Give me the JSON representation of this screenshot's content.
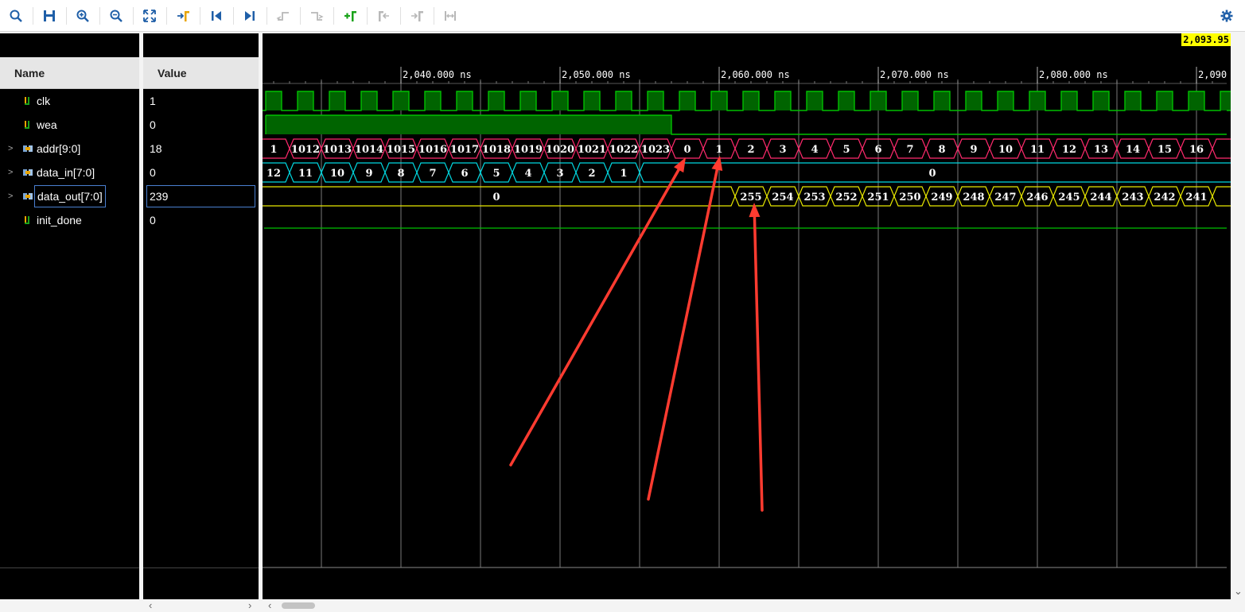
{
  "colors": {
    "signal_green": "#00c000",
    "signal_fill": "#006400",
    "bus_pink": "#ff2a6d",
    "bus_cyan": "#00d8e0",
    "bus_yellow": "#e8e800",
    "cursor_yellow": "#ffff00",
    "arrow_red": "#ff3b30",
    "toolbar_blue": "#1f5fa8"
  },
  "toolbar": {
    "buttons": [
      {
        "name": "search-icon",
        "icon": "magnifier"
      },
      {
        "name": "save-icon",
        "icon": "floppy"
      },
      {
        "name": "zoom-in-icon",
        "icon": "zoom-in"
      },
      {
        "name": "zoom-out-icon",
        "icon": "zoom-out"
      },
      {
        "name": "zoom-fit-icon",
        "icon": "fit"
      },
      {
        "name": "go-to-cursor-icon",
        "icon": "cursor"
      },
      {
        "name": "go-to-start-icon",
        "icon": "first"
      },
      {
        "name": "go-to-end-icon",
        "icon": "last"
      },
      {
        "name": "previous-transition-icon",
        "icon": "prev-edge"
      },
      {
        "name": "next-transition-icon",
        "icon": "next-edge"
      },
      {
        "name": "add-marker-icon",
        "icon": "add-marker"
      },
      {
        "name": "previous-marker-icon",
        "icon": "prev-marker"
      },
      {
        "name": "next-marker-icon",
        "icon": "next-marker"
      },
      {
        "name": "swap-cursors-icon",
        "icon": "swap"
      }
    ],
    "settings_icon": "gear-icon"
  },
  "headers": {
    "name": "Name",
    "value": "Value"
  },
  "signals": [
    {
      "name": "clk",
      "value": "1",
      "kind": "bit",
      "expandable": false
    },
    {
      "name": "wea",
      "value": "0",
      "kind": "bit",
      "expandable": false
    },
    {
      "name": "addr[9:0]",
      "value": "18",
      "kind": "bus",
      "expandable": true
    },
    {
      "name": "data_in[7:0]",
      "value": "0",
      "kind": "bus",
      "expandable": true
    },
    {
      "name": "data_out[7:0]",
      "value": "239",
      "kind": "bus",
      "expandable": true,
      "selected": true
    },
    {
      "name": "init_done",
      "value": "0",
      "kind": "bit",
      "expandable": false
    }
  ],
  "cursor_time": "2,093.95",
  "timeline": {
    "start_ns": 2036.35,
    "ns_per_unit": 10,
    "ticks": [
      "2,040.000 ns",
      "2,050.000 ns",
      "2,060.000 ns",
      "2,070.000 ns",
      "2,080.000 ns",
      "2,090"
    ]
  },
  "waves": {
    "addr_values": [
      "1",
      "1012",
      "1013",
      "1014",
      "1015",
      "1016",
      "1017",
      "1018",
      "1019",
      "1020",
      "1021",
      "1022",
      "1023",
      "0",
      "1",
      "2",
      "3",
      "4",
      "5",
      "6",
      "7",
      "8",
      "9",
      "10",
      "11",
      "12",
      "13",
      "14",
      "15",
      "16"
    ],
    "data_in_values": [
      "12",
      "11",
      "10",
      "9",
      "8",
      "7",
      "6",
      "5",
      "4",
      "3",
      "2",
      "1"
    ],
    "data_in_tail": "0",
    "data_out_head": "0",
    "data_out_values": [
      "255",
      "254",
      "253",
      "252",
      "251",
      "250",
      "249",
      "248",
      "247",
      "246",
      "245",
      "244",
      "243",
      "242",
      "241"
    ]
  },
  "scroll": {
    "left_arrow": "‹",
    "right_arrow": "›",
    "down_arrow": "⌄"
  }
}
